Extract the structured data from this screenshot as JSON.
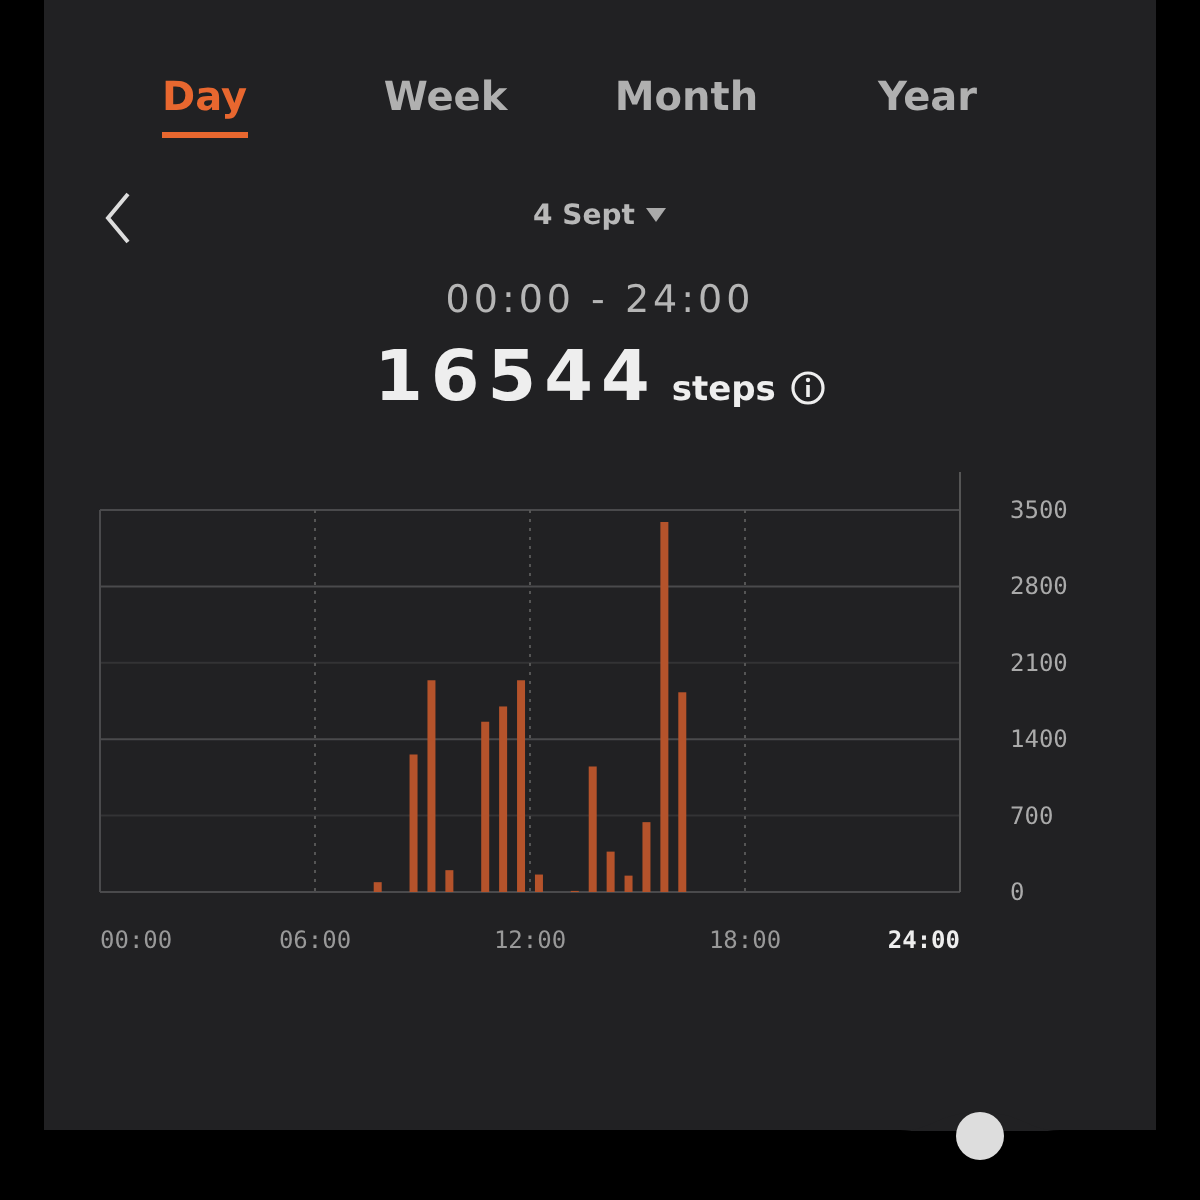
{
  "tabs": [
    {
      "label": "Day",
      "selected": true
    },
    {
      "label": "Week",
      "selected": false
    },
    {
      "label": "Month",
      "selected": false
    },
    {
      "label": "Year",
      "selected": false
    }
  ],
  "date": {
    "label": "4 Sept"
  },
  "range": "00:00 - 24:00",
  "total": {
    "value": "16544",
    "unit": "steps"
  },
  "chart_data": {
    "type": "bar",
    "x": [
      7.75,
      8.75,
      9.25,
      9.75,
      10.75,
      11.25,
      11.75,
      12.25,
      13.25,
      13.75,
      14.25,
      14.75,
      15.25,
      15.75,
      16.25
    ],
    "series": [
      {
        "color": "#b5532b",
        "values": [
          90,
          1260,
          1940,
          200,
          1560,
          1700,
          1940,
          160,
          10,
          1150,
          370,
          150,
          640,
          3390,
          1830
        ]
      }
    ],
    "xlim": [
      0,
      24
    ],
    "ylim": [
      0,
      3500
    ],
    "xticks": [
      {
        "value": 0,
        "label": "00:00"
      },
      {
        "value": 6,
        "label": "06:00"
      },
      {
        "value": 12,
        "label": "12:00"
      },
      {
        "value": 18,
        "label": "18:00"
      },
      {
        "value": 24,
        "label": "24:00"
      }
    ],
    "yticks": [
      0,
      700,
      1400,
      2100,
      2800,
      3500
    ],
    "grid": true
  }
}
